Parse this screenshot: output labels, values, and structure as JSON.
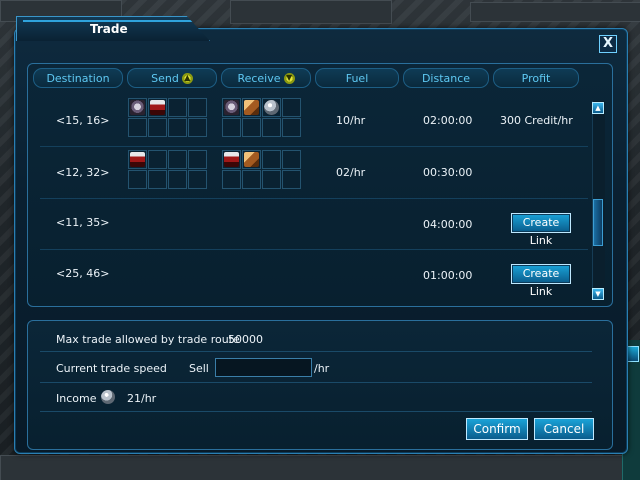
{
  "window": {
    "title": "Trade",
    "close_label": "X"
  },
  "table": {
    "headers": [
      {
        "label": "Destination",
        "icon": ""
      },
      {
        "label": "Send",
        "icon": "up-arrow-icon"
      },
      {
        "label": "Receive",
        "icon": "down-arrow-icon"
      },
      {
        "label": "Fuel",
        "icon": ""
      },
      {
        "label": "Distance",
        "icon": ""
      },
      {
        "label": "Profit",
        "icon": ""
      }
    ],
    "rows": [
      {
        "destination": "<15, 16>",
        "send_items": [
          "gear",
          "crate"
        ],
        "receive_items": [
          "gear",
          "box",
          "orb"
        ],
        "fuel": "10/hr",
        "distance": "02:00:00",
        "profit": "300  Credit/hr",
        "action": ""
      },
      {
        "destination": "<12, 32>",
        "send_items": [
          "crate"
        ],
        "receive_items": [
          "crate",
          "box"
        ],
        "fuel": "02/hr",
        "distance": "00:30:00",
        "profit": "",
        "action": ""
      },
      {
        "destination": "<11, 35>",
        "send_items": [],
        "receive_items": [],
        "fuel": "",
        "distance": "04:00:00",
        "profit": "",
        "action": "Create Link"
      },
      {
        "destination": "<25, 46>",
        "send_items": [],
        "receive_items": [],
        "fuel": "",
        "distance": "01:00:00",
        "profit": "",
        "action": "Create Link"
      }
    ]
  },
  "summary": {
    "max_trade_label": "Max trade allowed by trade route",
    "max_trade_value": "50000",
    "speed_label": "Current trade speed",
    "sell_label": "Sell",
    "sell_value": "",
    "speed_unit": "/hr",
    "income_label": "Income",
    "income_value": "21/hr"
  },
  "buttons": {
    "confirm": "Confirm",
    "cancel": "Cancel"
  },
  "colors": {
    "accent": "#2fa3dd",
    "header_text": "#5ec8f2",
    "button": "#1aa3d8"
  }
}
